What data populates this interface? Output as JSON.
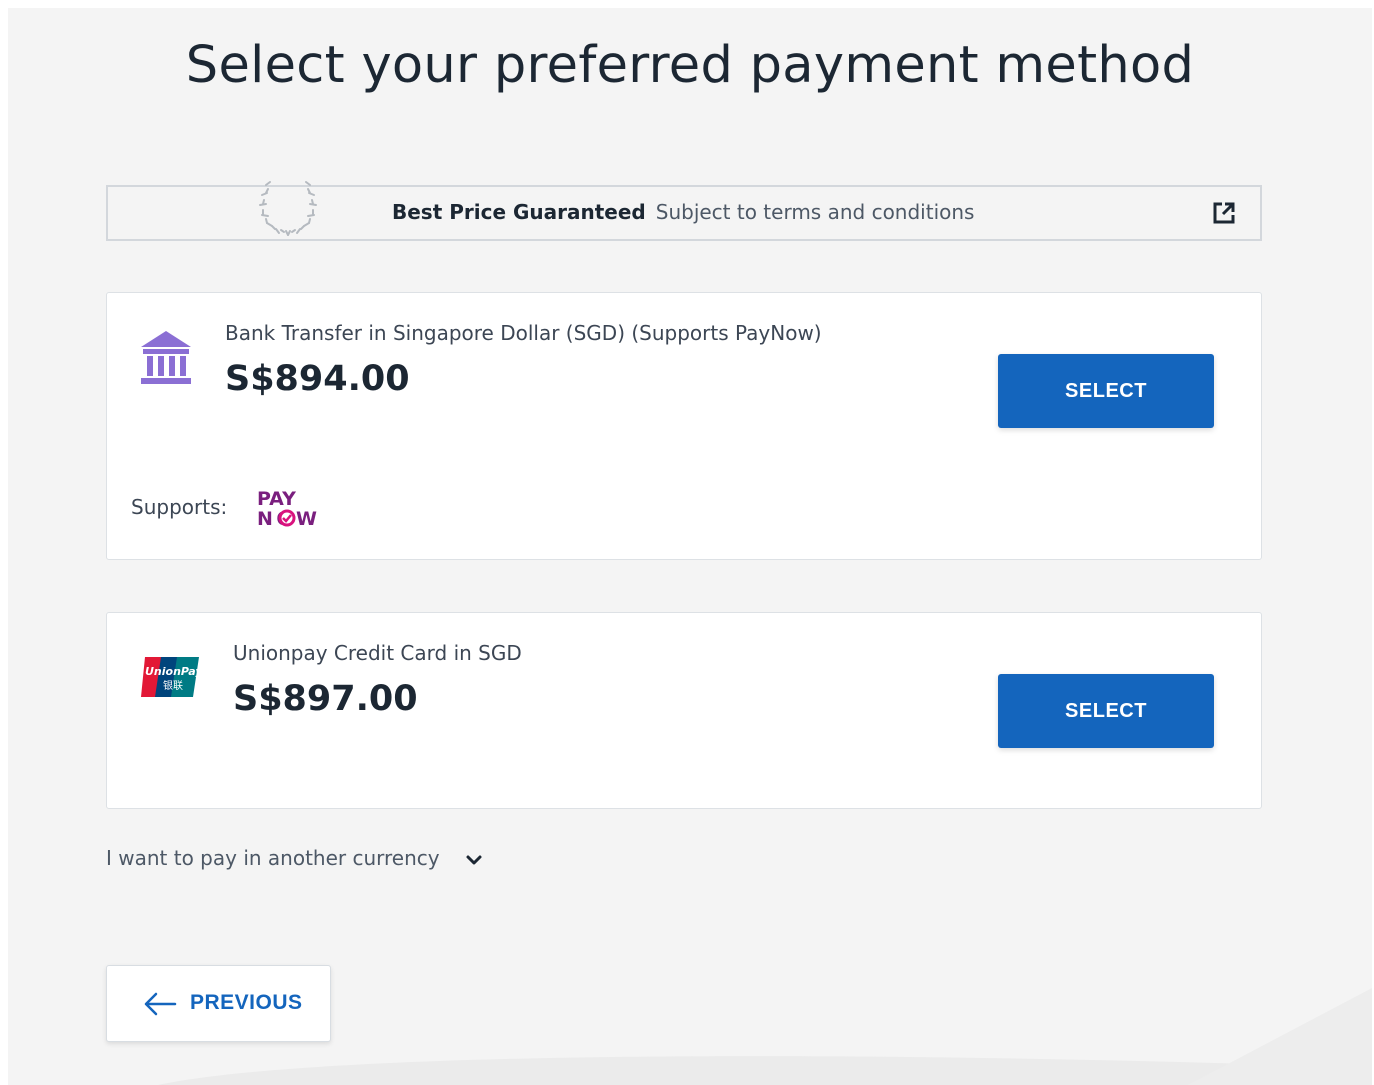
{
  "page": {
    "title": "Select your preferred payment method"
  },
  "banner": {
    "title": "Best Price Guaranteed",
    "subtitle": "Subject to terms and conditions",
    "icons": [
      "laurel-icon",
      "external-link-icon"
    ]
  },
  "payment_methods": [
    {
      "name": "Bank Transfer in Singapore Dollar (SGD) (Supports PayNow)",
      "price": "S$894.00",
      "button_label": "SELECT",
      "icon": "bank-icon",
      "icon_color": "#8b6fd4",
      "supports_label": "Supports:",
      "supports_logo_text": [
        "PAY",
        "NOW"
      ],
      "supports_logo_color": "#7a1f7e"
    },
    {
      "name": "Unionpay Credit Card in SGD",
      "price": "S$897.00",
      "button_label": "SELECT",
      "icon": "unionpay-icon",
      "logo_text": [
        "UnionPay",
        "银联"
      ]
    }
  ],
  "other_currency": {
    "label": "I want to pay in another currency",
    "icon": "chevron-down-icon"
  },
  "navigation": {
    "previous_label": "PREVIOUS",
    "icon": "arrow-left-icon"
  },
  "colors": {
    "accent": "#1465bd",
    "background": "#f4f4f4",
    "card": "#ffffff"
  }
}
